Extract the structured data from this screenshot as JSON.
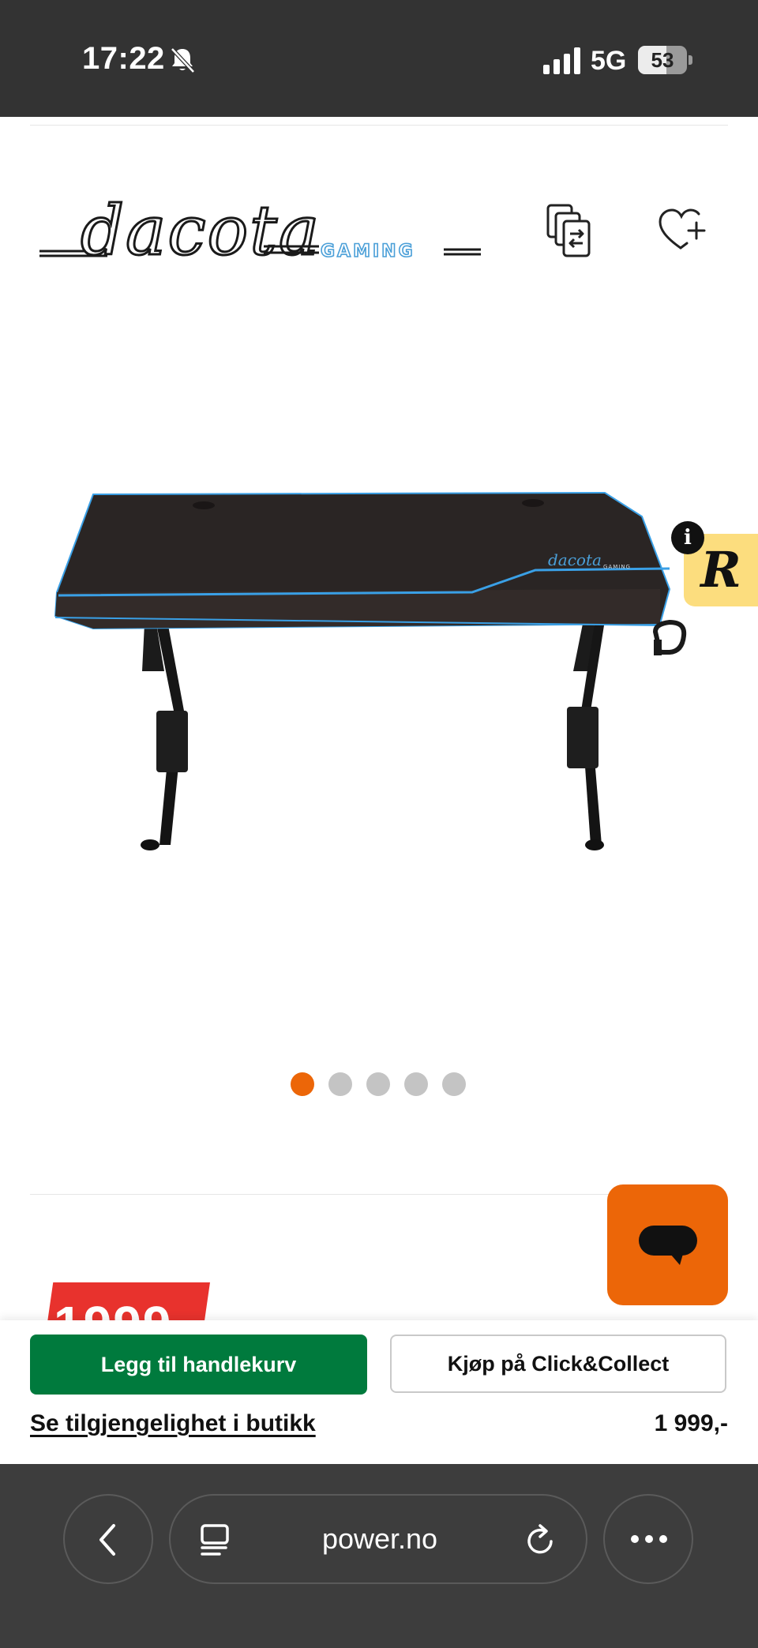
{
  "status_bar": {
    "time": "17:22",
    "network": "5G",
    "battery": "53",
    "battery_level": 0.53
  },
  "header": {
    "brand_logo_text": "dacota",
    "brand_logo_sub": "GAMING",
    "icons": [
      "compare-icon",
      "wishlist-icon"
    ]
  },
  "gallery": {
    "image_count": 5,
    "active_index": 0,
    "product_logo_text": "dacota",
    "product_logo_sub": "GAMING"
  },
  "retailer_badge": {
    "letter": "R",
    "info": "i"
  },
  "price_badge": {
    "text": "1999"
  },
  "actions": {
    "add_to_cart_label": "Legg til handlekurv",
    "click_collect_label": "Kjøp på Click&Collect",
    "store_availability_label": "Se tilgjengelighet i butikk",
    "price": "1 999,-"
  },
  "browser": {
    "url": "power.no"
  },
  "colors": {
    "accent": "#ec6608",
    "cart_green": "#007a3d",
    "price_red": "#e8322d",
    "status_bar": "#333333",
    "browser_bar": "#3d3d3d",
    "logo_blue": "#4a9fd8"
  }
}
